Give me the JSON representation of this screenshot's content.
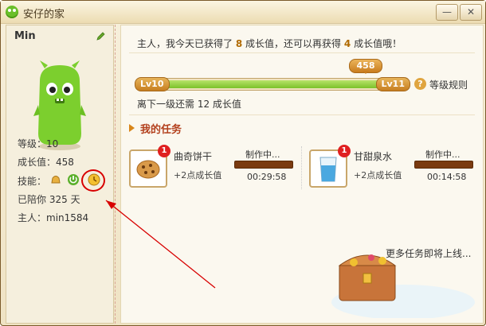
{
  "window": {
    "title": "安仔的家",
    "minimize_glyph": "—",
    "close_glyph": "✕"
  },
  "profile": {
    "name": "Min",
    "level_label": "等级：",
    "level": "10",
    "growth_label": "成长值：",
    "growth": "458",
    "skills_label": "技能：",
    "days_text_prefix": "已陪你",
    "days": "325",
    "days_unit": "天",
    "owner_label": "主人：",
    "owner": "min1584"
  },
  "summary": {
    "part1": "主人，我今天已获得了",
    "earned": "8",
    "part2": "成长值，还可以再获得",
    "remaining": "4",
    "part3": "成长值哦！"
  },
  "progress": {
    "start_level": "Lv10",
    "end_level": "Lv11",
    "current_value": "458",
    "fill_fraction": 0.93,
    "rules_label": "等级规则",
    "help_glyph": "?",
    "need_text": "离下一级还需 12 成长值"
  },
  "tasks": {
    "section_title": "我的任务",
    "items": [
      {
        "name": "曲奇饼干",
        "reward": "+2点成长值",
        "status": "制作中...",
        "time": "00:29:58",
        "badge": "1"
      },
      {
        "name": "甘甜泉水",
        "reward": "+2点成长值",
        "status": "制作中...",
        "time": "00:14:58",
        "badge": "1"
      }
    ],
    "more_text": "更多任务即将上线..."
  },
  "colors": {
    "accent": "#b3401d",
    "highlight": "#b06a00",
    "annotation": "#d80000"
  }
}
